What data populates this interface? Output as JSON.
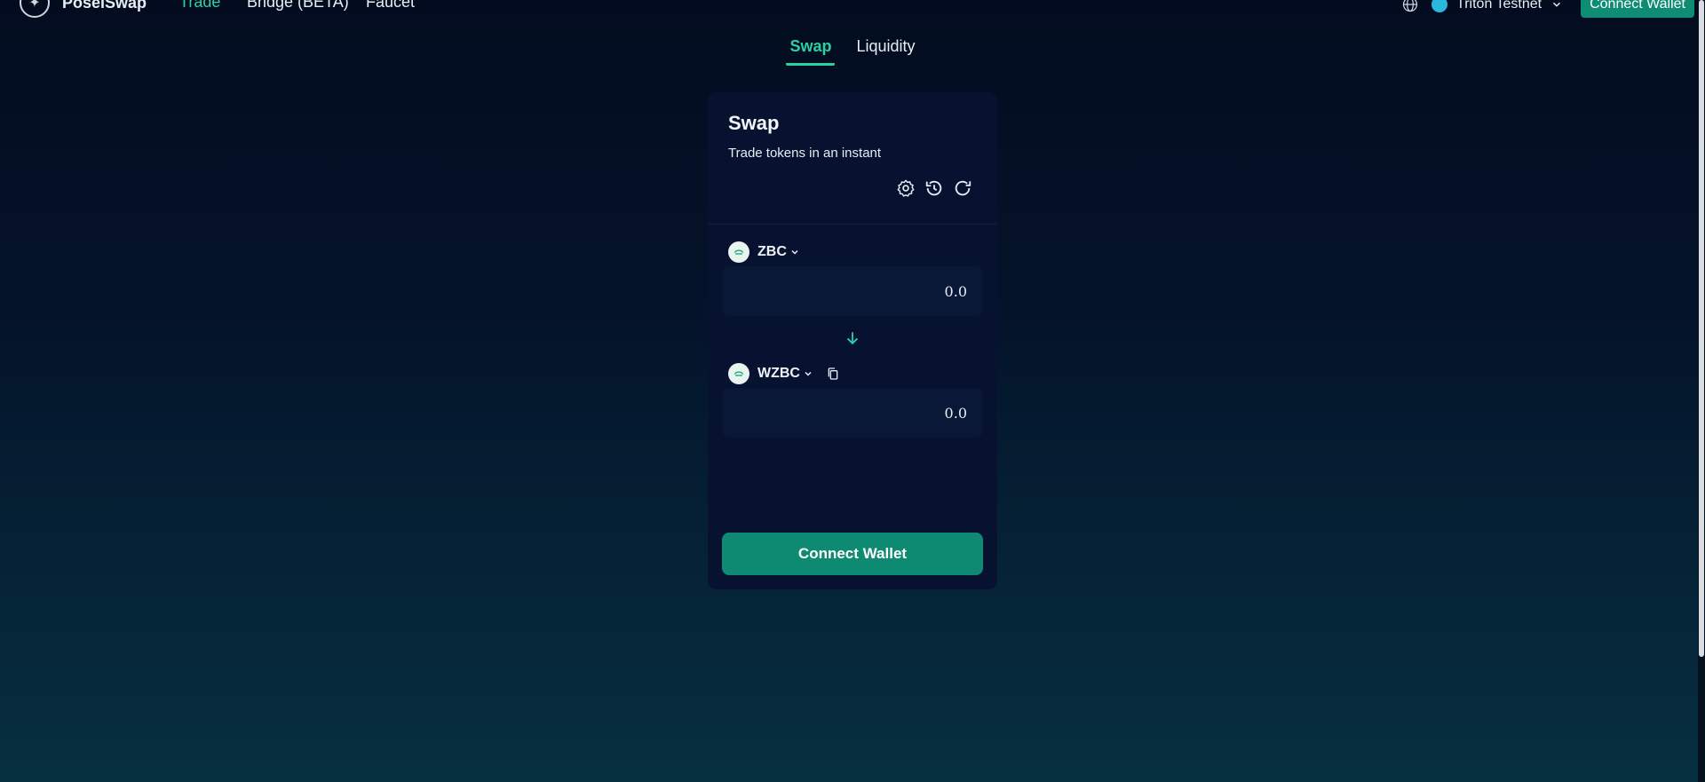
{
  "nav": {
    "brand": "PoselSwap",
    "links": [
      {
        "label": "Trade",
        "active": true
      },
      {
        "label": "Bridge (BETA)",
        "active": false
      },
      {
        "label": "Faucet",
        "active": false
      }
    ],
    "network": "Triton Testnet",
    "connect_label": "Connect Wallet"
  },
  "subtabs": [
    {
      "label": "Swap",
      "active": true
    },
    {
      "label": "Liquidity",
      "active": false
    }
  ],
  "card": {
    "title": "Swap",
    "subtitle": "Trade tokens in an instant",
    "tools": [
      "settings-icon",
      "history-icon",
      "refresh-icon"
    ],
    "from": {
      "token": "ZBC",
      "amount_placeholder": "0.0"
    },
    "to": {
      "token": "WZBC",
      "amount_placeholder": "0.0"
    },
    "connect_label": "Connect Wallet"
  },
  "colors": {
    "accent": "#2ad1a4",
    "button": "#0f8a72",
    "card_bg": "#061230",
    "input_bg": "#0a1838"
  }
}
